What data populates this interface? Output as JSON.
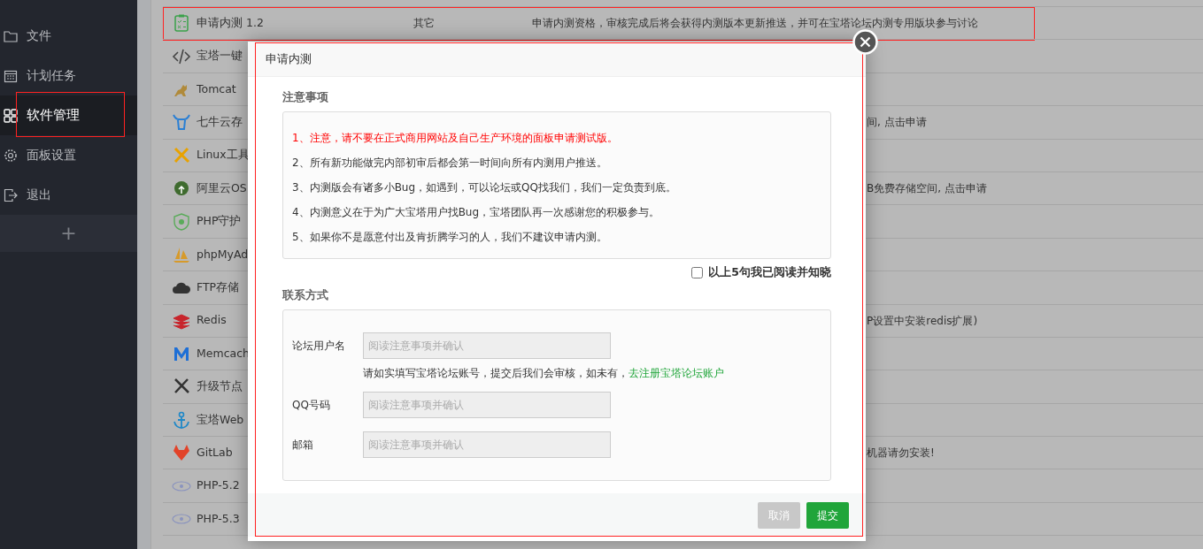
{
  "sidebar": {
    "items": [
      {
        "label": "文件",
        "selected": false,
        "annotated": false
      },
      {
        "label": "计划任务",
        "selected": false,
        "annotated": false
      },
      {
        "label": "软件管理",
        "selected": true,
        "annotated": true
      },
      {
        "label": "面板设置",
        "selected": false,
        "annotated": false
      },
      {
        "label": "退出",
        "selected": false,
        "annotated": false
      }
    ],
    "add_button": "+"
  },
  "software_table": {
    "rows": [
      {
        "name": "申请内测 1.2",
        "type": "其它",
        "description": "申请内测资格，审核完成后将会获得内测版本更新推送，并可在宝塔论坛内测专用版块参与讨论",
        "annotated": true
      },
      {
        "name": "宝塔一键",
        "annotated": false
      },
      {
        "name": "Tomcat",
        "annotated": false
      },
      {
        "name": "七牛云存",
        "description": "间, 点击申请",
        "annotated": false
      },
      {
        "name": "Linux工具",
        "annotated": false
      },
      {
        "name": "阿里云OS",
        "description": "B免费存储空间, 点击申请",
        "annotated": false
      },
      {
        "name": "PHP守护",
        "annotated": false
      },
      {
        "name": "phpMyAd",
        "annotated": false
      },
      {
        "name": "FTP存储",
        "annotated": false
      },
      {
        "name": "Redis",
        "description": "P设置中安装redis扩展)",
        "annotated": false
      },
      {
        "name": "Memcach",
        "annotated": false
      },
      {
        "name": "升级节点",
        "annotated": false
      },
      {
        "name": "宝塔Web",
        "annotated": false
      },
      {
        "name": "GitLab",
        "description": "机器请勿安装!",
        "annotated": false
      },
      {
        "name": "PHP-5.2",
        "annotated": false
      },
      {
        "name": "PHP-5.3",
        "annotated": false
      }
    ]
  },
  "dialog": {
    "title": "申请内测",
    "annotated": true,
    "notice_heading": "注意事项",
    "notices": [
      {
        "text": "1、注意，请不要在正式商用网站及自己生产环境的面板申请测试版。",
        "warning": true
      },
      {
        "text": "2、所有新功能做完内部初审后都会第一时间向所有内测用户推送。",
        "warning": false
      },
      {
        "text": "3、内测版会有诸多小Bug，如遇到，可以论坛或QQ找我们，我们一定负责到底。",
        "warning": false
      },
      {
        "text": "4、内测意义在于为广大宝塔用户找Bug，宝塔团队再一次感谢您的积极参与。",
        "warning": false
      },
      {
        "text": "5、如果你不是愿意付出及肯折腾学习的人，我们不建议申请内测。",
        "warning": false
      }
    ],
    "agree": {
      "label": "以上5句我已阅读并知晓",
      "checked": false
    },
    "contact_heading": "联系方式",
    "fields": [
      {
        "label": "论坛用户名",
        "placeholder": "阅读注意事项并确认",
        "disabled": true,
        "help": "请如实填写宝塔论坛账号，提交后我们会审核，如未有，",
        "help_link": "去注册宝塔论坛账户"
      },
      {
        "label": "QQ号码",
        "placeholder": "阅读注意事项并确认",
        "disabled": true
      },
      {
        "label": "邮箱",
        "placeholder": "阅读注意事项并确认",
        "disabled": true
      }
    ],
    "buttons": [
      {
        "label": "取消",
        "kind": "cancel"
      },
      {
        "label": "提交",
        "kind": "submit"
      }
    ]
  }
}
